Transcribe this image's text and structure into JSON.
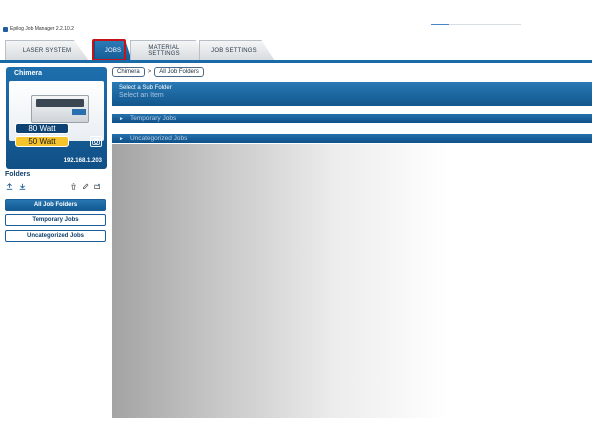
{
  "window": {
    "title": "Epilog Job Manager 2.2.10.2",
    "progress": 0.2
  },
  "tabs": [
    {
      "label": "LASER SYSTEM",
      "active": false
    },
    {
      "label": "JOBS",
      "active": true
    },
    {
      "label": "MATERIAL\nSETTINGS",
      "active": false
    },
    {
      "label": "JOB SETTINGS",
      "active": false
    }
  ],
  "laser": {
    "name": "Chimera",
    "power_primary": "80 Watt",
    "power_secondary": "50 Watt",
    "ip_address": "192.168.1.203"
  },
  "folders": {
    "title": "Folders",
    "items": [
      {
        "label": "All Job Folders",
        "selected": true
      },
      {
        "label": "Temporary Jobs",
        "selected": false
      },
      {
        "label": "Uncategorized Jobs",
        "selected": false
      }
    ]
  },
  "breadcrumb": {
    "items": [
      "Chimera",
      "All Job Folders"
    ],
    "separator": ">"
  },
  "subfolder": {
    "title": "Select a Sub Folder",
    "hint": "Select an Item"
  },
  "groups": [
    {
      "label": "Temporary Jobs"
    },
    {
      "label": "Uncategorized Jobs"
    }
  ],
  "colors": {
    "brand_blue": "#1a6aa8",
    "highlight_red": "#c4141a",
    "watt_yellow": "#f5c32c"
  },
  "icons": {
    "upload": "upload-icon",
    "download": "download-icon",
    "delete": "trash-icon",
    "edit": "pencil-icon",
    "new_folder": "folder-add-icon",
    "camera": "camera-icon"
  }
}
